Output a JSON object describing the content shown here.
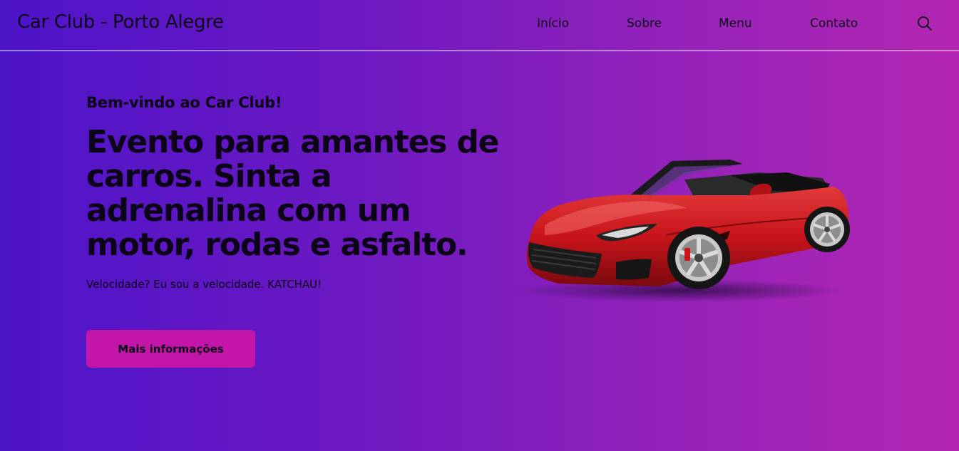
{
  "header": {
    "brand": "Car Club - Porto Alegre",
    "nav": [
      "Início",
      "Sobre",
      "Menu",
      "Contato"
    ]
  },
  "hero": {
    "subtitle": "Bem-vindo ao Car Club!",
    "title": "Evento para amantes de carros. Sinta a adrenalina com um motor, rodas e asfalto.",
    "tagline": "Velocidade? Eu sou a velocidade. KATCHAU!",
    "button_label": "Mais informações"
  },
  "colors": {
    "gradient_start": "#4d14c8",
    "gradient_end": "#b426b2",
    "button": "#c316a8",
    "car_body": "#c8141a"
  },
  "icons": {
    "search": "search-icon",
    "image": "red-convertible-sports-car"
  }
}
